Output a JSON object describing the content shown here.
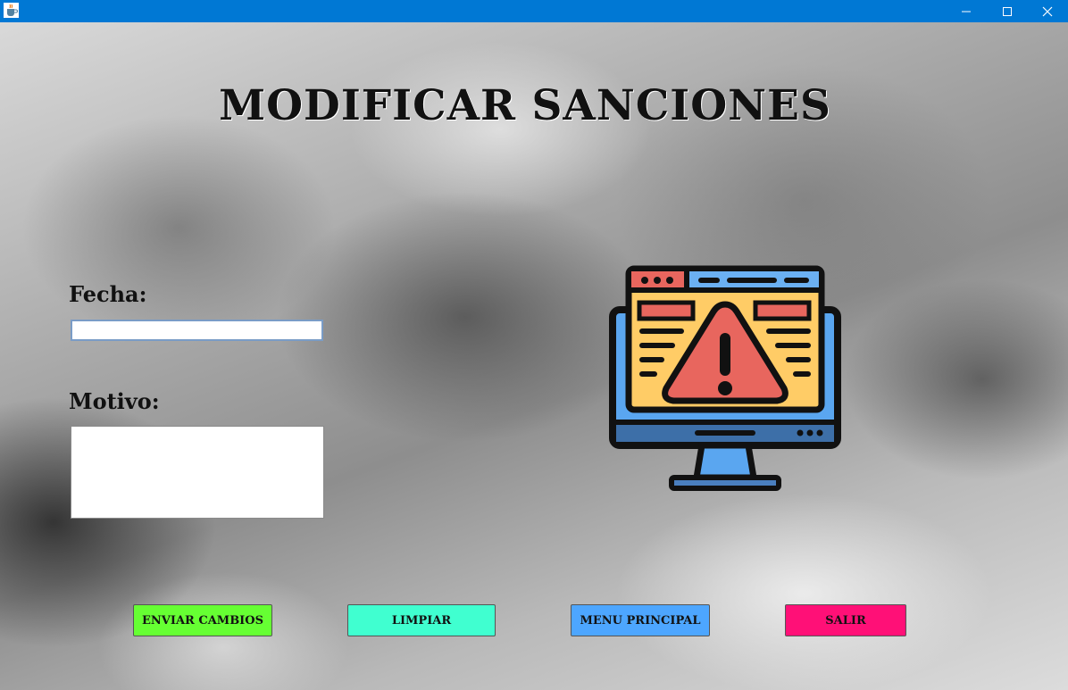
{
  "window": {
    "app_icon": "java-coffee-cup-icon",
    "controls": [
      "minimize-icon",
      "maximize-icon",
      "close-icon"
    ]
  },
  "form": {
    "title": "MODIFICAR SANCIONES",
    "fecha_label": "Fecha:",
    "fecha_value": "",
    "motivo_label": "Motivo:",
    "motivo_value": ""
  },
  "illustration": {
    "icon": "monitor-warning-icon"
  },
  "buttons": {
    "enviar": "ENVIAR CAMBIOS",
    "limpiar": "LIMPIAR",
    "menu": "MENU PRINCIPAL",
    "salir": "SALIR"
  },
  "colors": {
    "titlebar": "#0078d4",
    "enviar": "#66ff33",
    "limpiar": "#40ffd0",
    "menu": "#4da6ff",
    "salir": "#ff1077"
  }
}
